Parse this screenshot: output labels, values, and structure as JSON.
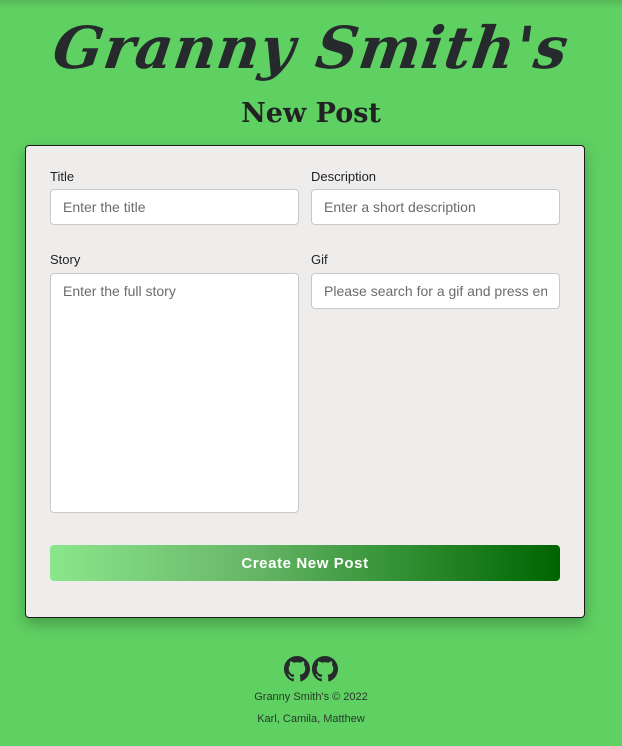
{
  "brand": "Granny Smith's",
  "page_title": "New Post",
  "form": {
    "title_label": "Title",
    "title_placeholder": "Enter the title",
    "description_label": "Description",
    "description_placeholder": "Enter a short description",
    "story_label": "Story",
    "story_placeholder": "Enter the full story",
    "gif_label": "Gif",
    "gif_placeholder": "Please search for a gif and press enter",
    "submit_label": "Create New Post"
  },
  "footer": {
    "icons": [
      "github-icon",
      "github-icon"
    ],
    "copyright": "Granny Smith's © 2022",
    "authors": "Karl, Camila, Matthew"
  },
  "colors": {
    "background": "#5fd062",
    "card": "#efecec",
    "button_gradient": [
      "#8be68c",
      "#006400"
    ]
  }
}
